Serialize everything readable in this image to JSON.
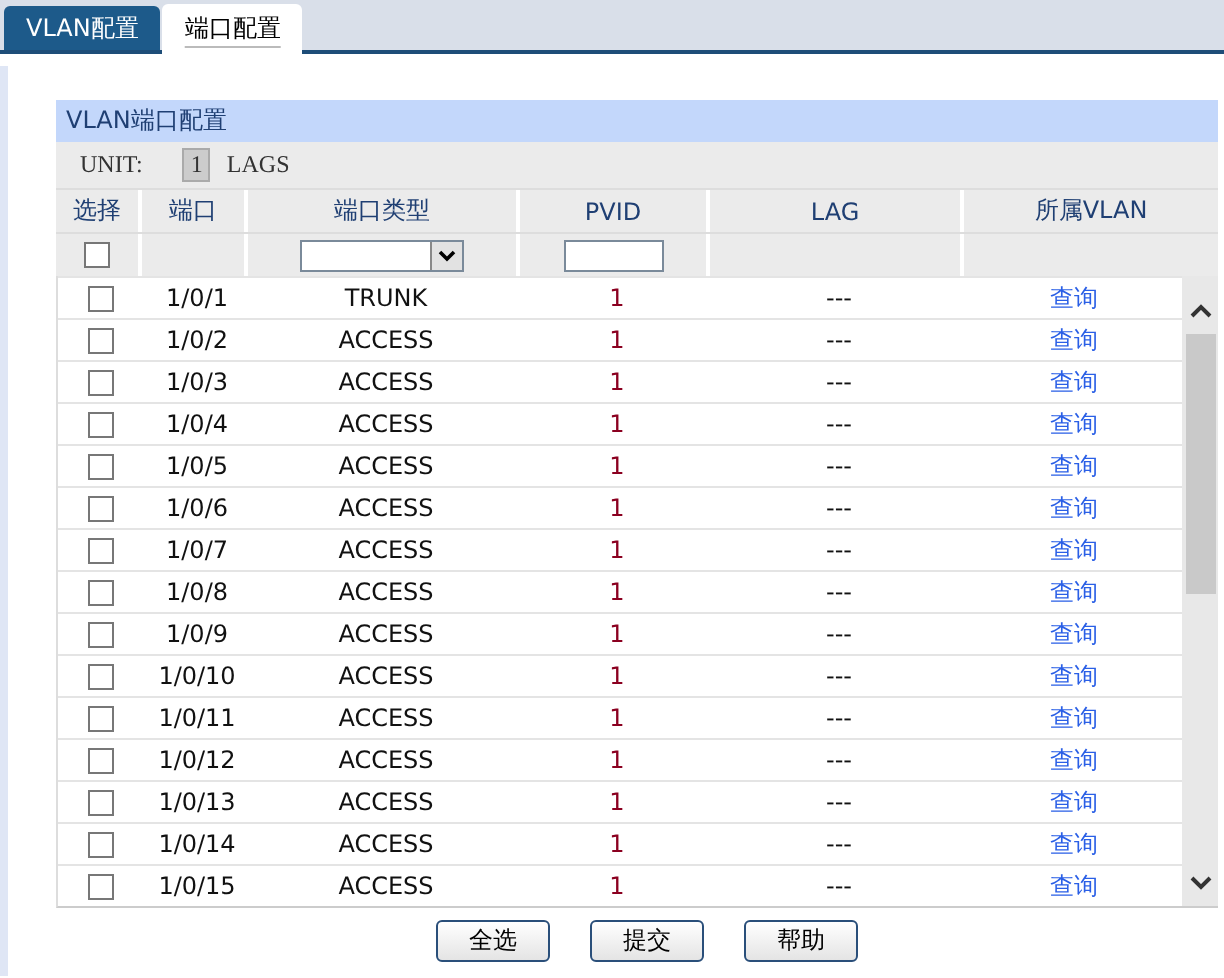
{
  "tabs": [
    {
      "label": "VLAN配置",
      "selected": false
    },
    {
      "label": "端口配置",
      "selected": true
    }
  ],
  "panel": {
    "title": "VLAN端口配置",
    "unit_label": "UNIT:",
    "unit_value": "1",
    "lags_label": "LAGS"
  },
  "columns": [
    "选择",
    "端口",
    "端口类型",
    "PVID",
    "LAG",
    "所属VLAN"
  ],
  "filter": {
    "select_all_checked": false
  },
  "rows": [
    {
      "checked": false,
      "port": "1/0/1",
      "type": "TRUNK",
      "pvid": "1",
      "lag": "---",
      "vlan": "查询"
    },
    {
      "checked": false,
      "port": "1/0/2",
      "type": "ACCESS",
      "pvid": "1",
      "lag": "---",
      "vlan": "查询"
    },
    {
      "checked": false,
      "port": "1/0/3",
      "type": "ACCESS",
      "pvid": "1",
      "lag": "---",
      "vlan": "查询"
    },
    {
      "checked": false,
      "port": "1/0/4",
      "type": "ACCESS",
      "pvid": "1",
      "lag": "---",
      "vlan": "查询"
    },
    {
      "checked": false,
      "port": "1/0/5",
      "type": "ACCESS",
      "pvid": "1",
      "lag": "---",
      "vlan": "查询"
    },
    {
      "checked": false,
      "port": "1/0/6",
      "type": "ACCESS",
      "pvid": "1",
      "lag": "---",
      "vlan": "查询"
    },
    {
      "checked": false,
      "port": "1/0/7",
      "type": "ACCESS",
      "pvid": "1",
      "lag": "---",
      "vlan": "查询"
    },
    {
      "checked": false,
      "port": "1/0/8",
      "type": "ACCESS",
      "pvid": "1",
      "lag": "---",
      "vlan": "查询"
    },
    {
      "checked": false,
      "port": "1/0/9",
      "type": "ACCESS",
      "pvid": "1",
      "lag": "---",
      "vlan": "查询"
    },
    {
      "checked": false,
      "port": "1/0/10",
      "type": "ACCESS",
      "pvid": "1",
      "lag": "---",
      "vlan": "查询"
    },
    {
      "checked": false,
      "port": "1/0/11",
      "type": "ACCESS",
      "pvid": "1",
      "lag": "---",
      "vlan": "查询"
    },
    {
      "checked": false,
      "port": "1/0/12",
      "type": "ACCESS",
      "pvid": "1",
      "lag": "---",
      "vlan": "查询"
    },
    {
      "checked": false,
      "port": "1/0/13",
      "type": "ACCESS",
      "pvid": "1",
      "lag": "---",
      "vlan": "查询"
    },
    {
      "checked": false,
      "port": "1/0/14",
      "type": "ACCESS",
      "pvid": "1",
      "lag": "---",
      "vlan": "查询"
    },
    {
      "checked": false,
      "port": "1/0/15",
      "type": "ACCESS",
      "pvid": "1",
      "lag": "---",
      "vlan": "查询"
    }
  ],
  "buttons": [
    "全选",
    "提交",
    "帮助"
  ]
}
